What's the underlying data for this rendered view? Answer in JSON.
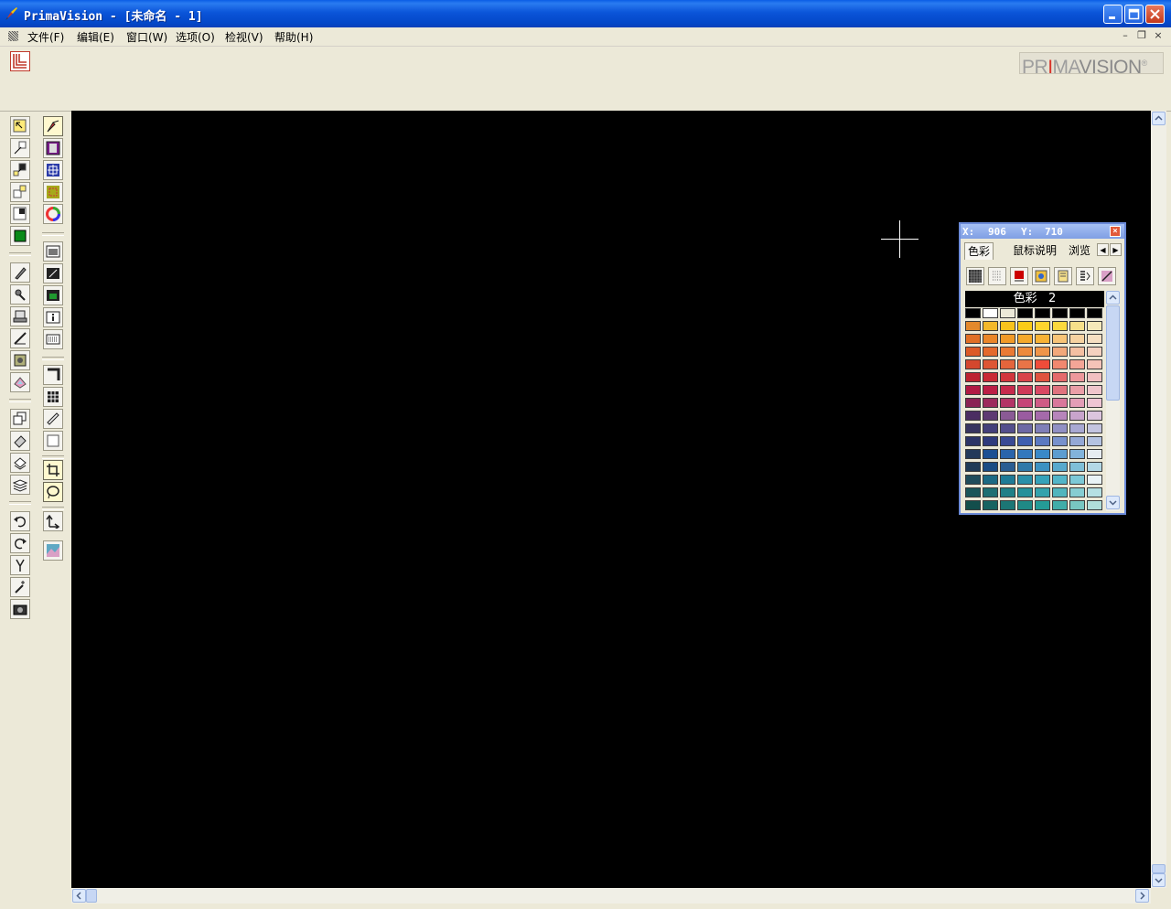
{
  "window": {
    "title": "PrimaVision - [未命名 - 1]"
  },
  "menu": {
    "items": [
      {
        "label": "文件(F)"
      },
      {
        "label": "编辑(E)"
      },
      {
        "label": "窗口(W)"
      },
      {
        "label": "选项(O)"
      },
      {
        "label": "检视(V)"
      },
      {
        "label": "帮助(H)"
      }
    ],
    "mdi_minimize": "–",
    "mdi_restore": "❐",
    "mdi_close": "×"
  },
  "brand": {
    "part1": "PR",
    "dot": "I",
    "part2": "MA",
    "part3": "VISION",
    "reg": "®"
  },
  "palette": {
    "x_label": "X:",
    "x_value": "906",
    "y_label": "Y:",
    "y_value": "710",
    "close": "×",
    "tabs": [
      "色彩",
      "鼠标说明",
      "浏览"
    ],
    "header": "色彩   2",
    "swatch_rows": [
      [
        "#000000",
        "#ffffff",
        "#ece9d8",
        "#000000",
        "#000000",
        "#000000",
        "#000000",
        "#000000"
      ],
      [
        "#e3892c",
        "#f3b82a",
        "#f8c31c",
        "#fbcc17",
        "#fdd52e",
        "#fcd93e",
        "#f6e08a",
        "#f6e9b9"
      ],
      [
        "#e06f25",
        "#ea8628",
        "#f19a27",
        "#f5a92a",
        "#f8b234",
        "#f8c477",
        "#f6d2a1",
        "#f6dfc2"
      ],
      [
        "#db5a27",
        "#e46a2c",
        "#ea7a33",
        "#ee8a3b",
        "#f09548",
        "#f2a87a",
        "#f4bfa2",
        "#f4d1c0"
      ],
      [
        "#d4472e",
        "#de5633",
        "#e4653c",
        "#e97447",
        "#ef4c3a",
        "#f1886f",
        "#f3a597",
        "#f4c3b8"
      ],
      [
        "#bd2431",
        "#c92b35",
        "#d2363d",
        "#d9454a",
        "#e0533f",
        "#e56a6b",
        "#ed989b",
        "#f2c0c1"
      ],
      [
        "#b01a44",
        "#bb1f45",
        "#c62a4c",
        "#cf3a58",
        "#d94963",
        "#e0737e",
        "#ea9ea7",
        "#f0c6cc"
      ],
      [
        "#8a2354",
        "#9c2a5c",
        "#b33566",
        "#c64577",
        "#cf5b85",
        "#d9789b",
        "#e39db6",
        "#eec5d3"
      ],
      [
        "#4b2d62",
        "#5e3a72",
        "#8a5a95",
        "#9a5ca0",
        "#a56aaa",
        "#b785bb",
        "#c8a4cc",
        "#dcc5de"
      ],
      [
        "#37345f",
        "#44407a",
        "#544f8c",
        "#6d69a5",
        "#7f7fb8",
        "#9190c4",
        "#a8a8d2",
        "#c4c5e0"
      ],
      [
        "#2c3467",
        "#2f3b7d",
        "#3a4a94",
        "#3f5fb0",
        "#5b79c1",
        "#7791cc",
        "#94a8d6",
        "#b4c3e2"
      ],
      [
        "#23395a",
        "#1c4f93",
        "#2a64ab",
        "#3378bd",
        "#3a89c8",
        "#5d9dd0",
        "#82b3db",
        "#e6ecf1"
      ],
      [
        "#1f3a57",
        "#1a4c84",
        "#2a5d92",
        "#2f79a9",
        "#3c91c1",
        "#58a9cd",
        "#7fbfd8",
        "#b3d8e6"
      ],
      [
        "#1f4c5b",
        "#1c6a84",
        "#1f7b96",
        "#2a90a9",
        "#35a2b9",
        "#52b5c8",
        "#7cc8d6",
        "#e9f3f6"
      ],
      [
        "#1a5559",
        "#1e6f73",
        "#208087",
        "#25919a",
        "#33a3ac",
        "#50b5bd",
        "#86cdd2",
        "#b5e0e3"
      ],
      [
        "#134e4c",
        "#176362",
        "#1c7675",
        "#1f8a86",
        "#249b97",
        "#41ada9",
        "#78c6c2",
        "#b0dedb"
      ]
    ]
  }
}
